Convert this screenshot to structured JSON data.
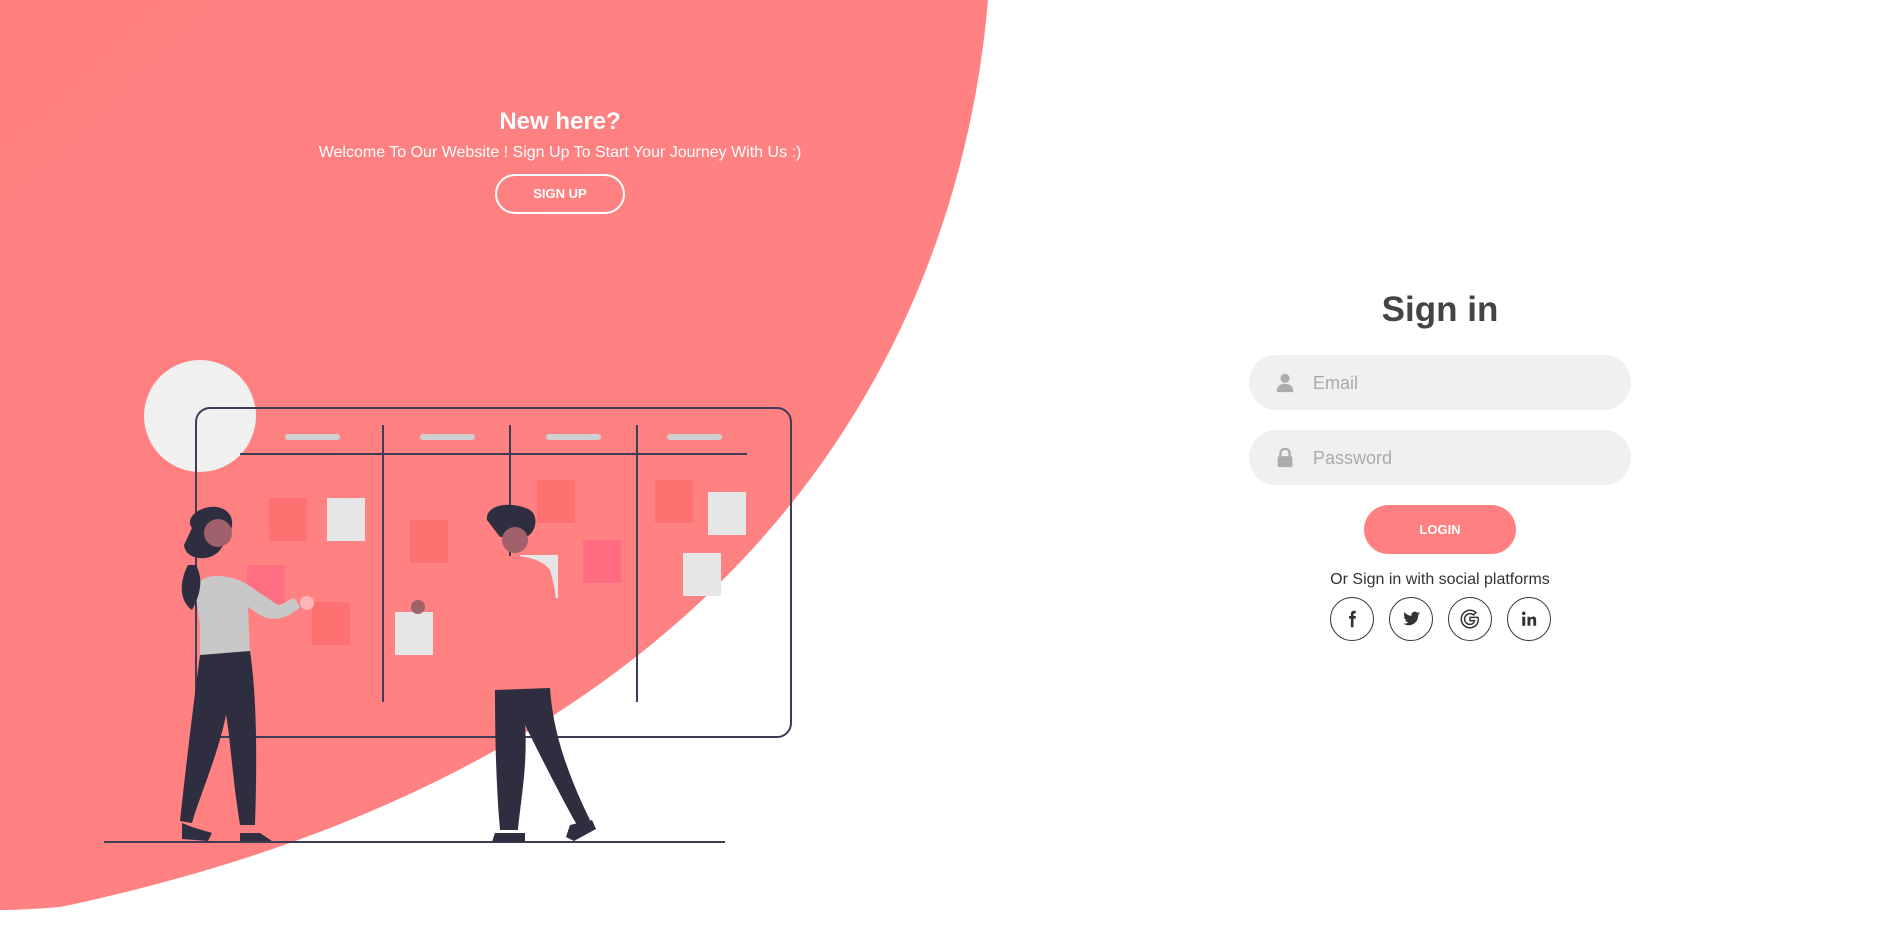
{
  "colors": {
    "accent": "#ff8080",
    "input_bg": "#f0f0f0",
    "heading": "#444444",
    "figure_dark": "#2f2e41"
  },
  "left_panel": {
    "heading": "New here?",
    "description": "Welcome To Our Website ! Sign Up To Start Your Journey With Us :)",
    "signup_button": "SIGN UP"
  },
  "signin_form": {
    "title": "Sign in",
    "email": {
      "icon": "user-icon",
      "placeholder": "Email",
      "value": ""
    },
    "password": {
      "icon": "lock-icon",
      "placeholder": "Password",
      "value": ""
    },
    "login_button": "LOGIN",
    "social_text": "Or Sign in with social platforms",
    "social": [
      {
        "name": "facebook",
        "icon": "facebook-icon"
      },
      {
        "name": "twitter",
        "icon": "twitter-icon"
      },
      {
        "name": "google",
        "icon": "google-icon"
      },
      {
        "name": "linkedin",
        "icon": "linkedin-icon"
      }
    ]
  }
}
